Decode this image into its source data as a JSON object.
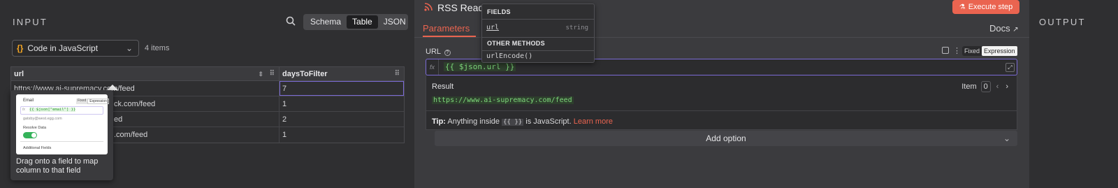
{
  "input": {
    "title": "INPUT",
    "view_tabs": [
      "Schema",
      "Table",
      "JSON"
    ],
    "active_view": "Table",
    "node_select": {
      "label": "Code in JavaScript"
    },
    "items_count": "4 items",
    "table": {
      "headers": [
        "url",
        "daysToFilter"
      ],
      "rows": [
        {
          "url": "https://www.ai-supremacy.com/feed",
          "days": "7"
        },
        {
          "url": "https://…substack.com/feed",
          "days": "1"
        },
        {
          "url": "https://…/feed",
          "days": "2"
        },
        {
          "url": "https://…com/feed",
          "days": "1"
        }
      ],
      "visible_row_text": [
        "ck.com/feed",
        "ed",
        ".com/feed"
      ]
    },
    "drag_tooltip": {
      "text": "Drag onto a field to map column to that field",
      "preview": {
        "email_label": "Email",
        "fixed": "Fixed",
        "expression": "Expression",
        "code": "{{ $json[\"email\"] }}",
        "value": "gatsby@west.egg.com",
        "resolve_label": "Resolve Data",
        "additional": "Additional Fields"
      }
    }
  },
  "ndv": {
    "node_title": "RSS Read",
    "execute_button": "Execute step",
    "tab_parameters": "Parameters",
    "docs_label": "Docs",
    "url_label": "URL",
    "mode_fixed": "Fixed",
    "mode_expression": "Expression",
    "fx_label": "fx",
    "expression": "{{ $json.url }}",
    "result_label": "Result",
    "item_label": "Item",
    "item_value": "0",
    "result_value": "https://www.ai-supremacy.com/feed",
    "tip_prefix": "Tip:",
    "tip_text_1": "Anything inside",
    "tip_code": "{{ }}",
    "tip_text_2": "is JavaScript.",
    "tip_link": "Learn more",
    "add_option": "Add option",
    "autocomplete": {
      "fields_title": "FIELDS",
      "field_name": "url",
      "field_type": "string",
      "methods_title": "OTHER METHODS",
      "method_name": "urlEncode()"
    }
  },
  "output": {
    "title": "OUTPUT"
  },
  "colors": {
    "accent": "#ea6450",
    "expression_border": "#7b6bd6",
    "code_green": "#7dd67a"
  }
}
